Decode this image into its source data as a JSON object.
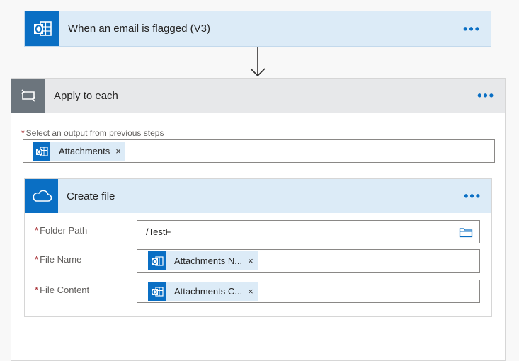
{
  "trigger": {
    "title": "When an email is flagged (V3)",
    "more": "•••"
  },
  "loop": {
    "title": "Apply to each",
    "more": "•••",
    "select_label": "Select an output from previous steps",
    "required_mark": "*",
    "token": {
      "label": "Attachments",
      "remove": "×"
    }
  },
  "create_file": {
    "title": "Create file",
    "more": "•••",
    "fields": [
      {
        "label": "Folder Path",
        "required_mark": "*",
        "value": "/TestF"
      },
      {
        "label": "File Name",
        "required_mark": "*",
        "token_label": "Attachments N...",
        "remove": "×"
      },
      {
        "label": "File Content",
        "required_mark": "*",
        "token_label": "Attachments C...",
        "remove": "×"
      }
    ]
  },
  "colors": {
    "accent": "#0a6fc4",
    "header_bg": "#dcebf7",
    "loop_icon_bg": "#6c757d"
  }
}
